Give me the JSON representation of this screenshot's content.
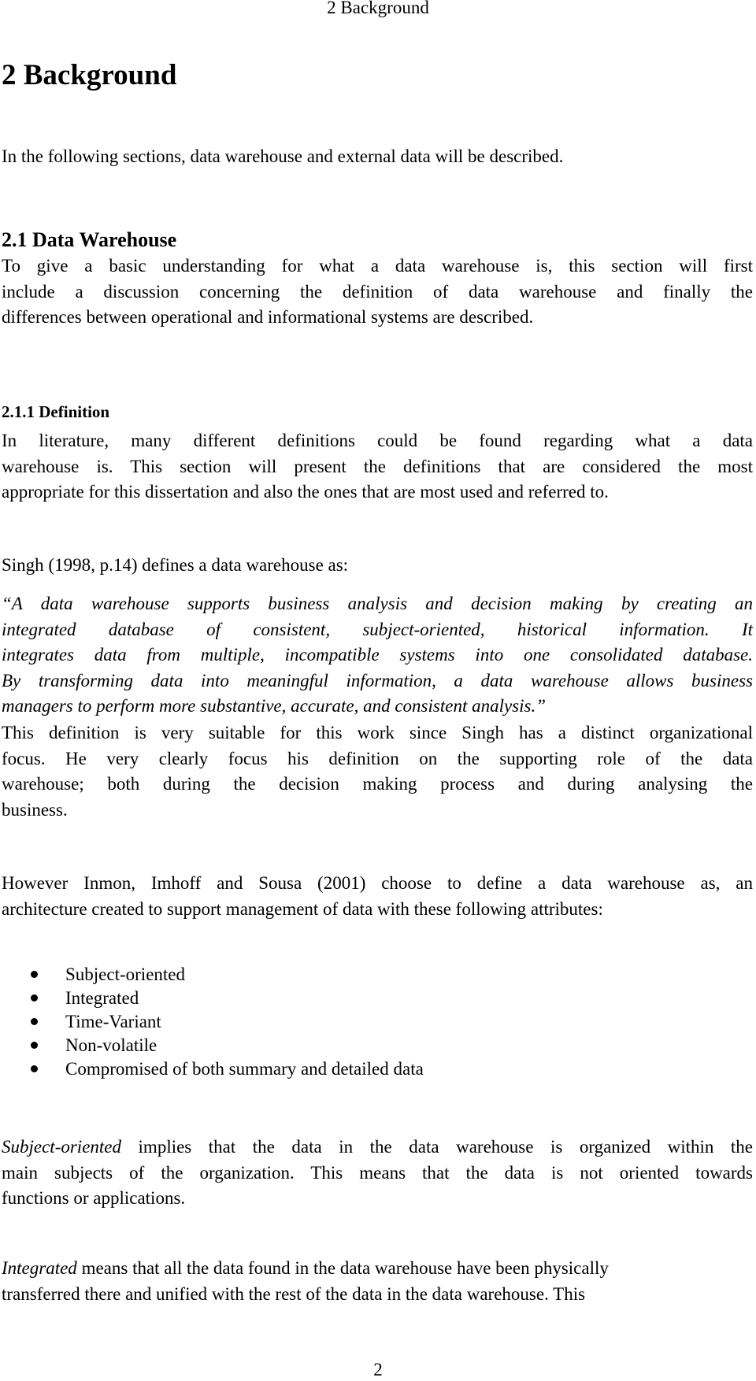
{
  "document": {
    "running_header": "2 Background",
    "chapter_title": "2 Background",
    "intro": "In the following sections, data warehouse and external data will be described.",
    "section": {
      "title": "2.1 Data Warehouse",
      "paragraph_lines": [
        "To give a basic understanding for what a data warehouse is, this section will first",
        "include a discussion concerning the definition of data warehouse and finally the",
        "differences between operational and informational systems are described."
      ]
    },
    "subsection": {
      "title": "2.1.1 Definition",
      "paragraph_lines": [
        "In literature, many different definitions could be found regarding what a data",
        "warehouse is. This section will present the definitions that are considered the most",
        "appropriate for this dissertation and also the ones that are most used and referred to."
      ]
    },
    "singh_intro": "Singh (1998, p.14) defines a data warehouse as:",
    "singh_quote_lines": [
      "“A data warehouse supports business analysis and decision making by creating an",
      "integrated database of consistent, subject-oriented, historical information. It",
      "integrates data from multiple, incompatible systems into one consolidated database.",
      "By transforming data into meaningful information, a data warehouse allows business",
      "managers to perform more substantive, accurate, and consistent analysis.”"
    ],
    "singh_comment_lines": [
      "This definition is very suitable for this work since Singh has a distinct organizational",
      "focus. He very clearly focus his definition on the supporting role of the data",
      "warehouse; both during the decision making process and during analysing the",
      "business."
    ],
    "inmon_lines": [
      "However Inmon, Imhoff and Sousa (2001) choose to define a data warehouse as, an",
      "architecture created to support management of data with these following attributes:"
    ],
    "attributes": [
      "Subject-oriented",
      "Integrated",
      "Time-Variant",
      "Non-volatile",
      "Compromised of both summary and detailed data"
    ],
    "subject_oriented": {
      "term": "Subject-oriented",
      "line1_rest": " implies that the data in the data warehouse is organized within the",
      "line2": "main subjects of the organization. This means that the data is not oriented towards",
      "line3": "functions or applications."
    },
    "integrated": {
      "term": "Integrated",
      "line1_rest": " means that all the data found in the data warehouse have been physically",
      "line2": "transferred there and unified with the rest of the data in the data warehouse. This"
    },
    "page_number": "2"
  }
}
